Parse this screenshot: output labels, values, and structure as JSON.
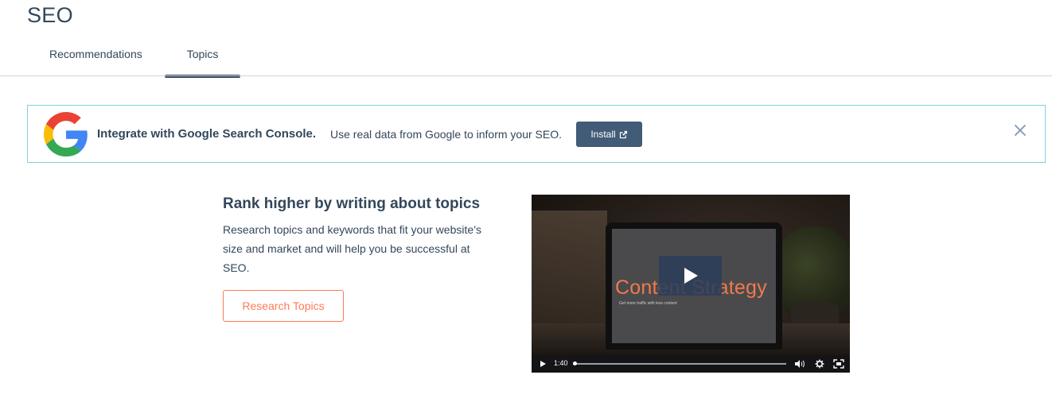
{
  "page": {
    "title": "SEO"
  },
  "tabs": [
    {
      "label": "Recommendations",
      "active": false
    },
    {
      "label": "Topics",
      "active": true
    }
  ],
  "banner": {
    "logo_icon": "google-icon",
    "title": "Integrate with Google Search Console.",
    "description": "Use real data from Google to inform your SEO.",
    "install_label": "Install",
    "install_icon": "external-link-icon",
    "close_icon": "close-icon"
  },
  "promo": {
    "heading": "Rank higher by writing about topics",
    "text": "Research topics and keywords that fit your website’s size and market and will help you be successful at SEO.",
    "button_label": "Research Topics"
  },
  "video": {
    "screen_title": "Content Strategy",
    "screen_subtitle": "Get more traffic with less content",
    "time": "1:40",
    "progress": 0.0,
    "controls": [
      "play-icon",
      "volume-icon",
      "settings-icon",
      "fullscreen-icon"
    ]
  },
  "colors": {
    "text": "#33475b",
    "accent": "#ff7a59",
    "banner_border": "#7fd1de",
    "install_bg": "#425b76",
    "divider": "#cbd6e2"
  }
}
